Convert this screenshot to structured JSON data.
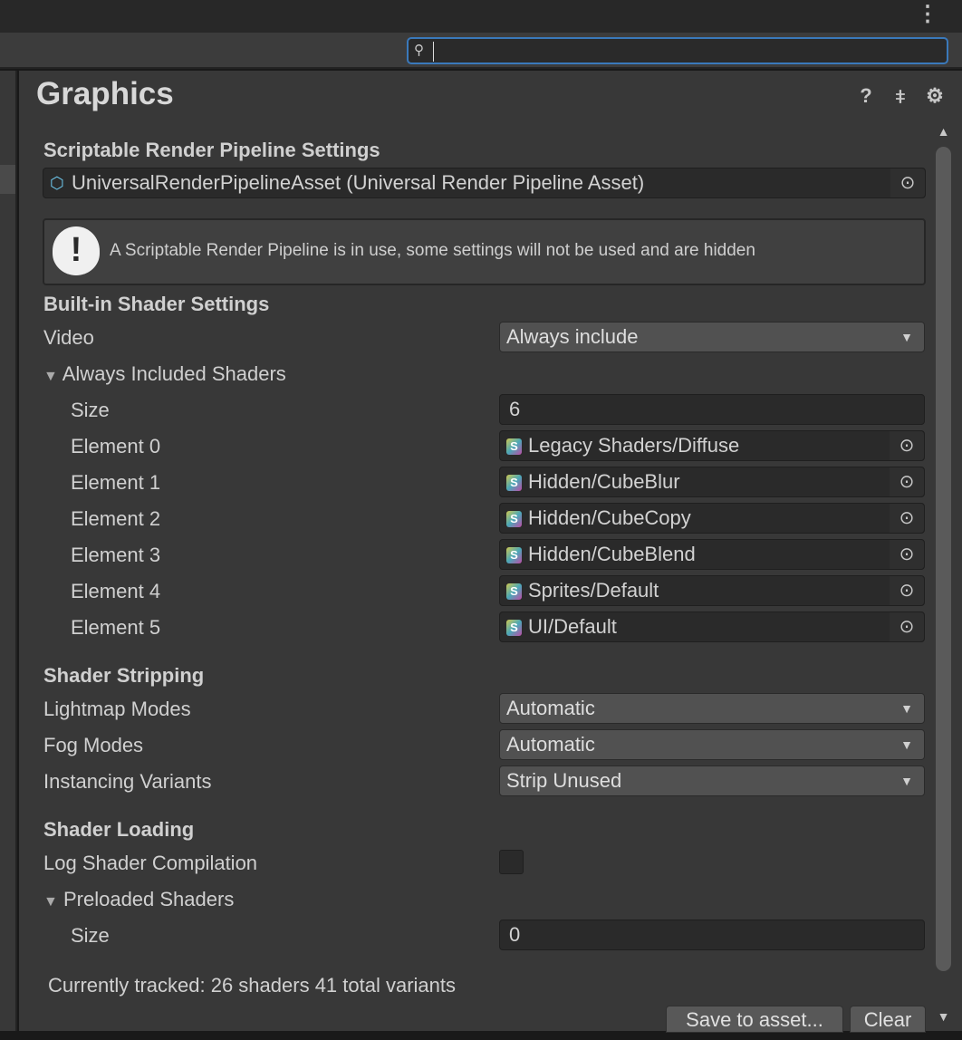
{
  "toolbar": {
    "search_value": "",
    "search_icon": "search-icon",
    "menu_icon": "kebab-menu-icon"
  },
  "header": {
    "title": "Graphics",
    "icons": [
      "help-icon",
      "presets-icon",
      "gear-icon"
    ]
  },
  "srp": {
    "heading": "Scriptable Render Pipeline Settings",
    "asset": "UniversalRenderPipelineAsset (Universal Render Pipeline Asset)",
    "help": "A Scriptable Render Pipeline is in use, some settings will not be used and are hidden"
  },
  "builtin": {
    "heading": "Built-in Shader Settings",
    "video_label": "Video",
    "video_value": "Always include",
    "always_label": "Always Included Shaders",
    "size_label": "Size",
    "size_value": "6",
    "elements": [
      {
        "label": "Element 0",
        "value": "Legacy Shaders/Diffuse"
      },
      {
        "label": "Element 1",
        "value": "Hidden/CubeBlur"
      },
      {
        "label": "Element 2",
        "value": "Hidden/CubeCopy"
      },
      {
        "label": "Element 3",
        "value": "Hidden/CubeBlend"
      },
      {
        "label": "Element 4",
        "value": "Sprites/Default"
      },
      {
        "label": "Element 5",
        "value": "UI/Default"
      }
    ]
  },
  "stripping": {
    "heading": "Shader Stripping",
    "lightmap_label": "Lightmap Modes",
    "lightmap_value": "Automatic",
    "fog_label": "Fog Modes",
    "fog_value": "Automatic",
    "instancing_label": "Instancing Variants",
    "instancing_value": "Strip Unused"
  },
  "loading": {
    "heading": "Shader Loading",
    "log_label": "Log Shader Compilation",
    "log_checked": false,
    "preloaded_label": "Preloaded Shaders",
    "size_label": "Size",
    "size_value": "0"
  },
  "footer": {
    "tracked": "Currently tracked: 26 shaders 41 total variants",
    "save_label": "Save to asset...",
    "clear_label": "Clear"
  },
  "colors": {
    "accent": "#3a79bb",
    "panel": "#383838"
  }
}
